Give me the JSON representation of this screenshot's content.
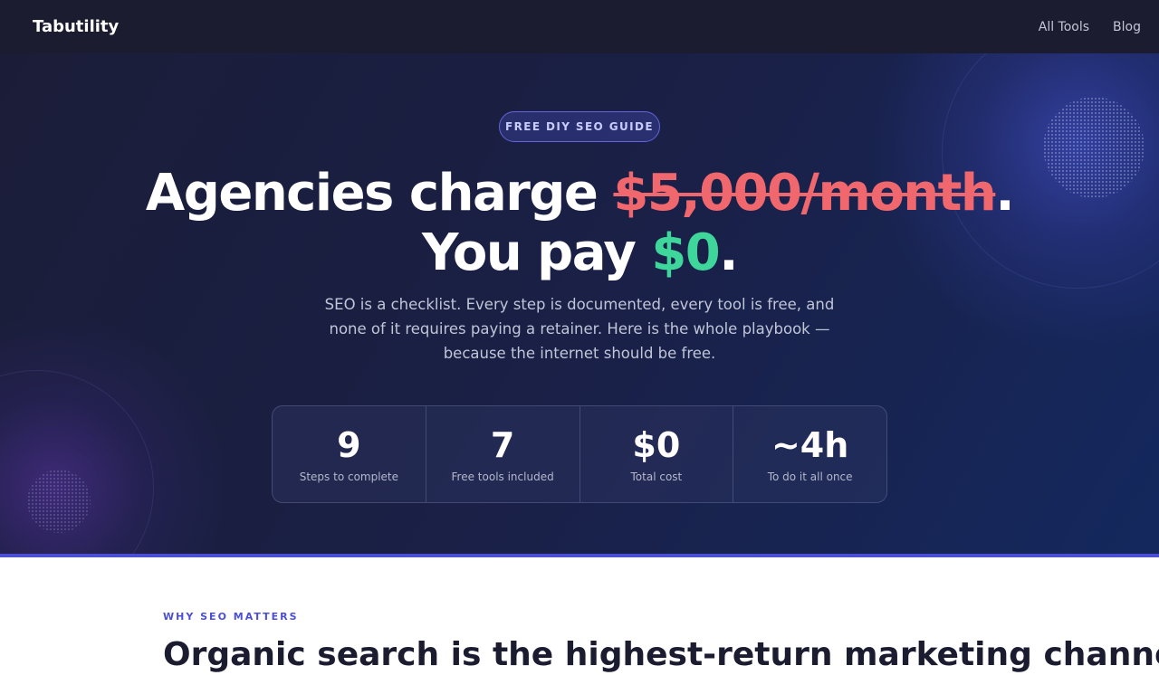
{
  "nav": {
    "brand": "Tabutility",
    "links": [
      "All Tools",
      "Blog"
    ]
  },
  "hero": {
    "badge": "FREE DIY SEO GUIDE",
    "headline": {
      "line1_prefix": "Agencies charge ",
      "line1_strike": "$5,000/month",
      "line1_suffix": ".",
      "line2_prefix": "You pay ",
      "line2_highlight": "$0",
      "line2_suffix": "."
    },
    "subtitle": "SEO is a checklist. Every step is documented, every tool is free, and none of it requires paying a retainer. Here is the whole playbook — because the internet should be free.",
    "stats": [
      {
        "value": "9",
        "label": "Steps to complete"
      },
      {
        "value": "7",
        "label": "Free tools included"
      },
      {
        "value": "$0",
        "label": "Total cost"
      },
      {
        "value": "~4h",
        "label": "To do it all once"
      }
    ]
  },
  "why": {
    "kicker": "WHY SEO MATTERS",
    "heading": "Organic search is the highest-return marketing channel"
  },
  "colors": {
    "accent": "#4b4fd6",
    "strike_price": "#f0686e",
    "free_price": "#3ed69b",
    "nav_bg": "#1b1c30"
  }
}
